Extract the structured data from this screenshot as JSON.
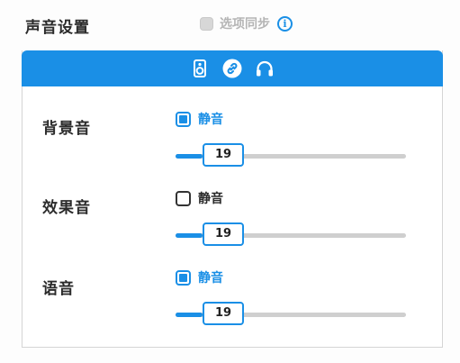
{
  "header": {
    "title": "声音设置",
    "sync_label": "选项同步",
    "sync_checked": false
  },
  "tabs": [
    {
      "icon": "speaker-icon"
    },
    {
      "icon": "link-icon",
      "active": true
    },
    {
      "icon": "headphones-icon"
    }
  ],
  "rows": [
    {
      "label": "背景音",
      "mute_label": "静音",
      "muted": true,
      "value": "19"
    },
    {
      "label": "效果音",
      "mute_label": "静音",
      "muted": false,
      "value": "19"
    },
    {
      "label": "语音",
      "mute_label": "静音",
      "muted": true,
      "value": "19"
    }
  ],
  "colors": {
    "accent": "#1a8fe6",
    "track": "#cfcfcf",
    "text": "#2b2b2b"
  }
}
